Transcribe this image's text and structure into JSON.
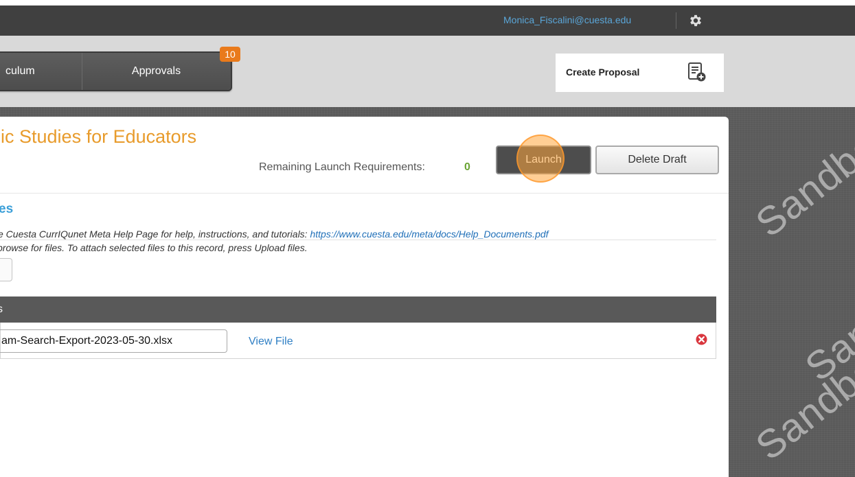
{
  "header": {
    "user_email": "Monica_Fiscalini@cuesta.edu",
    "settings_icon": "gear-icon"
  },
  "nav": {
    "tabs": [
      {
        "label": "culum"
      },
      {
        "label": "Approvals"
      }
    ],
    "approvals_badge": "10",
    "create_proposal_label": "Create Proposal",
    "create_proposal_icon": "add-document-icon"
  },
  "watermark": {
    "text": "Sandbox"
  },
  "proposal": {
    "title": "nic Studies for Educators",
    "remaining_label": "Remaining Launch Requirements:",
    "remaining_count": "0",
    "launch_label": "Launch",
    "delete_label": "Delete Draft"
  },
  "attachments": {
    "section_title": "es",
    "help_prefix": "e Cuesta CurrIQunet Meta Help Page for help, instructions, and tutorials:",
    "help_link": "https://www.cuesta.edu/meta/docs/Help_Documents.pdf",
    "browse_text": "browse for files. To attach selected files to this record, press Upload files.",
    "table_header": "s",
    "files": [
      {
        "name": "am-Search-Export-2023-05-30.xlsx",
        "view_label": "View File"
      }
    ]
  },
  "colors": {
    "accent_orange": "#e89b2b",
    "link_blue": "#2f7fc4",
    "heading_blue": "#3b9fd8",
    "requirement_green": "#6aa434",
    "badge_orange": "#e97a1b",
    "remove_red": "#d9363e"
  }
}
